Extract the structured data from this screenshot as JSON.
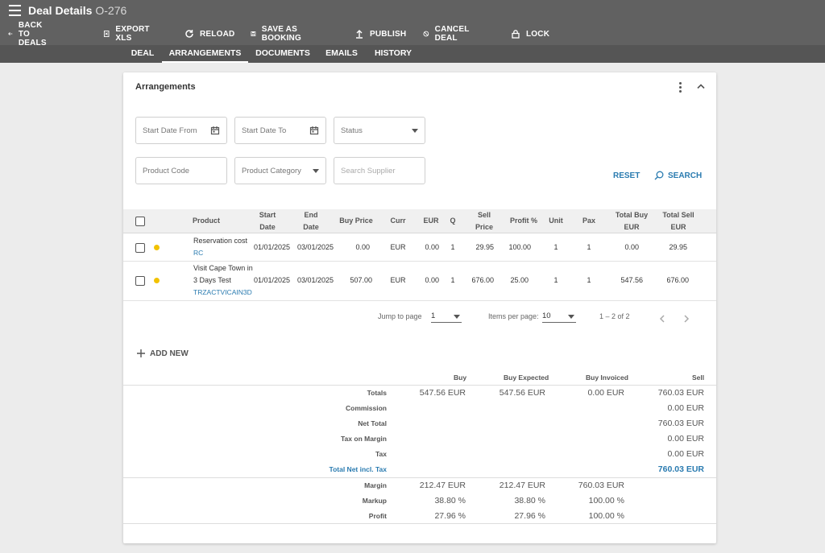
{
  "header": {
    "title": "Deal Details",
    "code": "O-276"
  },
  "actions": [
    {
      "label": "BACK TO DEALS",
      "icon": "arrow-left-icon"
    },
    {
      "label": "EXPORT XLS",
      "icon": "excel-icon"
    },
    {
      "label": "RELOAD",
      "icon": "reload-icon"
    },
    {
      "label": "SAVE AS BOOKING",
      "icon": "save-icon"
    },
    {
      "label": "PUBLISH",
      "icon": "publish-icon"
    },
    {
      "label": "CANCEL DEAL",
      "icon": "cancel-icon"
    },
    {
      "label": "LOCK",
      "icon": "lock-icon"
    }
  ],
  "tabs": [
    {
      "label": "DEAL"
    },
    {
      "label": "ARRANGEMENTS",
      "active": true
    },
    {
      "label": "DOCUMENTS"
    },
    {
      "label": "EMAILS"
    },
    {
      "label": "HISTORY"
    }
  ],
  "card": {
    "title": "Arrangements"
  },
  "filters": {
    "start_date_from": "Start Date From",
    "start_date_to": "Start Date To",
    "status": "Status",
    "product_code": "Product Code",
    "product_category": "Product Category",
    "search_supplier": "Search Supplier",
    "reset": "RESET",
    "search": "SEARCH"
  },
  "table": {
    "headers": {
      "product": "Product",
      "start_date_1": "Start",
      "start_date_2": "Date",
      "end_date_1": "End",
      "end_date_2": "Date",
      "buy_price": "Buy Price",
      "curr": "Curr",
      "eur": "EUR",
      "q": "Q",
      "sell_price_1": "Sell",
      "sell_price_2": "Price",
      "profit": "Profit %",
      "unit": "Unit",
      "pax": "Pax",
      "total_buy_1": "Total Buy",
      "total_buy_2": "EUR",
      "total_sell_1": "Total Sell",
      "total_sell_2": "EUR"
    },
    "rows": [
      {
        "product_line1": "Reservation cost",
        "product_line2": "",
        "code": "RC",
        "start": "01/01/2025",
        "end": "03/01/2025",
        "buy_price": "0.00",
        "curr": "EUR",
        "eur": "0.00",
        "q": "1",
        "sell_price": "29.95",
        "profit": "100.00",
        "unit": "1",
        "pax": "1",
        "total_buy": "0.00",
        "total_sell": "29.95",
        "status_color": "#f2c200"
      },
      {
        "product_line1": "Visit Cape Town in",
        "product_line2": "3 Days Test",
        "code": "TRZACTVICAIN3D",
        "start": "01/01/2025",
        "end": "03/01/2025",
        "buy_price": "507.00",
        "curr": "EUR",
        "eur": "0.00",
        "q": "1",
        "sell_price": "676.00",
        "profit": "25.00",
        "unit": "1",
        "pax": "1",
        "total_buy": "547.56",
        "total_sell": "676.00",
        "status_color": "#f2c200"
      }
    ]
  },
  "pager": {
    "jump_label": "Jump to page",
    "jump_value": "1",
    "items_label": "Items per page:",
    "items_value": "10",
    "range": "1 – 2 of 2"
  },
  "add_new": "ADD NEW",
  "summary": {
    "headers": {
      "buy": "Buy",
      "buy_expected": "Buy Expected",
      "buy_invoiced": "Buy Invoiced",
      "sell": "Sell"
    },
    "rows": [
      {
        "label": "Totals",
        "buy": "547.56 EUR",
        "buy_expected": "547.56 EUR",
        "buy_invoiced": "0.00 EUR",
        "sell": "760.03 EUR"
      },
      {
        "label": "Commission",
        "buy": "",
        "buy_expected": "",
        "buy_invoiced": "",
        "sell": "0.00 EUR"
      },
      {
        "label": "Net Total",
        "buy": "",
        "buy_expected": "",
        "buy_invoiced": "",
        "sell": "760.03 EUR"
      },
      {
        "label": "Tax on Margin",
        "buy": "",
        "buy_expected": "",
        "buy_invoiced": "",
        "sell": "0.00 EUR"
      },
      {
        "label": "Tax",
        "buy": "",
        "buy_expected": "",
        "buy_invoiced": "",
        "sell": "0.00 EUR"
      },
      {
        "label": "Total Net incl. Tax",
        "buy": "",
        "buy_expected": "",
        "buy_invoiced": "",
        "sell": "760.03 EUR",
        "accent": true
      },
      {
        "label": "Margin",
        "buy": "212.47 EUR",
        "buy_expected": "212.47 EUR",
        "buy_invoiced": "760.03 EUR",
        "sell": ""
      },
      {
        "label": "Markup",
        "buy": "38.80 %",
        "buy_expected": "38.80 %",
        "buy_invoiced": "100.00 %",
        "sell": ""
      },
      {
        "label": "Profit",
        "buy": "27.96 %",
        "buy_expected": "27.96 %",
        "buy_invoiced": "100.00 %",
        "sell": ""
      }
    ]
  },
  "colors": {
    "topbar": "#616161",
    "tabbar": "#555555",
    "accent": "#2a7bb0",
    "status_dot": "#f2c200"
  }
}
